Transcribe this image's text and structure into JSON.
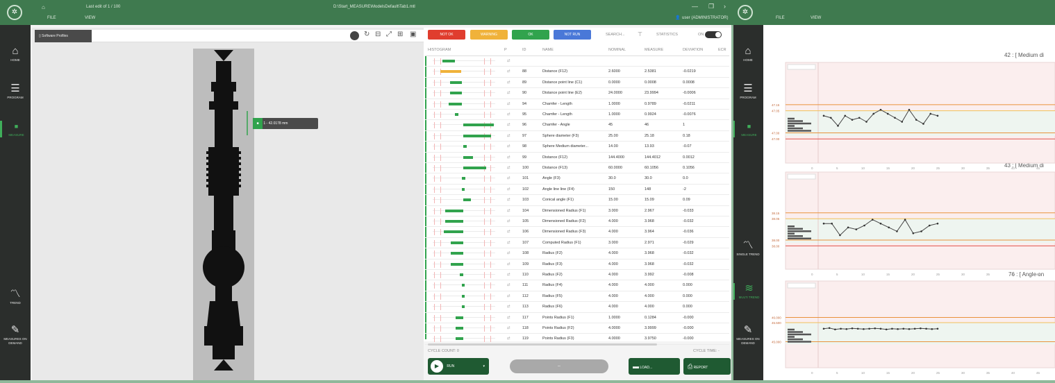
{
  "left_window": {
    "title_bar": {
      "file_label": "FILE",
      "view_label": "VIEW",
      "recent_label": "Last edit of 1 / 100",
      "title": "D:\\Start_MEASURE\\ModelsDefault\\Tab1.mtl",
      "user": "user (ADMINISTRATOR)"
    },
    "sidebar": {
      "items": [
        {
          "label": "HOME",
          "icon": "home-icon"
        },
        {
          "label": "PROGRAM",
          "icon": "list-icon"
        },
        {
          "label": "MEASURE",
          "icon": "measure-icon"
        },
        {
          "label": "TREND",
          "icon": "trend-icon"
        },
        {
          "label": "MEASURES ON DEMAND",
          "icon": "wand-icon"
        }
      ]
    },
    "viewer": {
      "tab_label": "Software Profiles",
      "measure_tag": "1 - 42.0178 mm"
    },
    "table": {
      "buttons": {
        "not_ok": "NOT OK",
        "warning": "WARNING",
        "ok": "OK",
        "not_run": "NOT RUN"
      },
      "toolbar": {
        "search": "SEARCH...",
        "statistics": "STATISTICS",
        "on": "ON"
      },
      "headers": {
        "histogram": "HISTOGRAM",
        "p": "P",
        "id": "ID",
        "name": "NAME",
        "nominal": "NOMINAL",
        "measure": "MEASURE",
        "deviation": "DEVIATION",
        "extra": "ECR"
      },
      "rows": [
        {
          "id": "",
          "name": "",
          "nominal": "",
          "measure": "",
          "deviation": ""
        },
        {
          "id": "88",
          "name": "Distance (F12)",
          "nominal": "2.6000",
          "measure": "2.5381",
          "deviation": "-0.0219"
        },
        {
          "id": "89",
          "name": "Distance point line (C1)",
          "nominal": "0.0000",
          "measure": "0.0008",
          "deviation": "0.0008"
        },
        {
          "id": "90",
          "name": "Distance point line (E2)",
          "nominal": "24.0000",
          "measure": "23.9994",
          "deviation": "-0.0006"
        },
        {
          "id": "94",
          "name": "Chamfer - Length",
          "nominal": "1.0000",
          "measure": "0.9789",
          "deviation": "-0.0211"
        },
        {
          "id": "95",
          "name": "Chamfer - Length",
          "nominal": "1.0000",
          "measure": "0.9924",
          "deviation": "-0.0076"
        },
        {
          "id": "96",
          "name": "Chamfer - Angle",
          "nominal": "45",
          "measure": "46",
          "deviation": "1"
        },
        {
          "id": "97",
          "name": "Sphere diameter (F3)",
          "nominal": "25.00",
          "measure": "25.18",
          "deviation": "0.18"
        },
        {
          "id": "98",
          "name": "Sphere Medium diameter...",
          "nominal": "14.00",
          "measure": "13.93",
          "deviation": "-0.07"
        },
        {
          "id": "99",
          "name": "Distance (F12)",
          "nominal": "144.4000",
          "measure": "144.4012",
          "deviation": "0.0012"
        },
        {
          "id": "100",
          "name": "Distance (F13)",
          "nominal": "60.0000",
          "measure": "60.1056",
          "deviation": "0.1056"
        },
        {
          "id": "101",
          "name": "Angle (F3)",
          "nominal": "30.0",
          "measure": "30.0",
          "deviation": "0.0"
        },
        {
          "id": "102",
          "name": "Angle line line (F4)",
          "nominal": "150",
          "measure": "148",
          "deviation": "-2"
        },
        {
          "id": "103",
          "name": "Conical angle (F1)",
          "nominal": "15.00",
          "measure": "15.09",
          "deviation": "0.09"
        },
        {
          "id": "104",
          "name": "Dimensioned Radius (F1)",
          "nominal": "3.000",
          "measure": "2.967",
          "deviation": "-0.033"
        },
        {
          "id": "105",
          "name": "Dimensioned Radius (F2)",
          "nominal": "4.000",
          "measure": "3.968",
          "deviation": "-0.032"
        },
        {
          "id": "106",
          "name": "Dimensioned Radius (F3)",
          "nominal": "4.000",
          "measure": "3.964",
          "deviation": "-0.036"
        },
        {
          "id": "107",
          "name": "Computed Radius (F1)",
          "nominal": "3.000",
          "measure": "2.971",
          "deviation": "-0.029"
        },
        {
          "id": "108",
          "name": "Radius (F2)",
          "nominal": "4.000",
          "measure": "3.968",
          "deviation": "-0.032"
        },
        {
          "id": "109",
          "name": "Radius (F3)",
          "nominal": "4.000",
          "measure": "3.968",
          "deviation": "-0.032"
        },
        {
          "id": "110",
          "name": "Radius (F2)",
          "nominal": "4.000",
          "measure": "3.992",
          "deviation": "-0.008"
        },
        {
          "id": "111",
          "name": "Radius (F4)",
          "nominal": "4.000",
          "measure": "4.000",
          "deviation": "0.000"
        },
        {
          "id": "112",
          "name": "Radius (F5)",
          "nominal": "4.000",
          "measure": "4.000",
          "deviation": "0.000"
        },
        {
          "id": "113",
          "name": "Radius (F6)",
          "nominal": "4.000",
          "measure": "4.000",
          "deviation": "0.000"
        },
        {
          "id": "117",
          "name": "Points Radius (F1)",
          "nominal": "1.0000",
          "measure": "0.1284",
          "deviation": "-0.000"
        },
        {
          "id": "118",
          "name": "Points Radius (F2)",
          "nominal": "4.0000",
          "measure": "3.9999",
          "deviation": "-0.000"
        },
        {
          "id": "119",
          "name": "Points Radius (F3)",
          "nominal": "4.0000",
          "measure": "3.9750",
          "deviation": "-0.000"
        }
      ],
      "histogram_fills": [
        {
          "start": 0.16,
          "width": 0.2,
          "color": "#31a34d"
        },
        {
          "start": 0.12,
          "width": 0.35,
          "color": "#f0b23a"
        },
        {
          "start": 0.28,
          "width": 0.2,
          "color": "#31a34d"
        },
        {
          "start": 0.28,
          "width": 0.2,
          "color": "#31a34d"
        },
        {
          "start": 0.26,
          "width": 0.22,
          "color": "#31a34d"
        },
        {
          "start": 0.36,
          "width": 0.06,
          "color": "#31a34d"
        },
        {
          "start": 0.5,
          "width": 0.5,
          "color": "#31a34d"
        },
        {
          "start": 0.5,
          "width": 0.45,
          "color": "#31a34d"
        },
        {
          "start": 0.5,
          "width": 0.06,
          "color": "#31a34d"
        },
        {
          "start": 0.5,
          "width": 0.16,
          "color": "#31a34d"
        },
        {
          "start": 0.5,
          "width": 0.38,
          "color": "#31a34d"
        },
        {
          "start": 0.48,
          "width": 0.05,
          "color": "#31a34d"
        },
        {
          "start": 0.48,
          "width": 0.04,
          "color": "#31a34d"
        },
        {
          "start": 0.5,
          "width": 0.12,
          "color": "#31a34d"
        },
        {
          "start": 0.2,
          "width": 0.3,
          "color": "#31a34d"
        },
        {
          "start": 0.2,
          "width": 0.3,
          "color": "#31a34d"
        },
        {
          "start": 0.18,
          "width": 0.32,
          "color": "#31a34d"
        },
        {
          "start": 0.3,
          "width": 0.2,
          "color": "#31a34d"
        },
        {
          "start": 0.3,
          "width": 0.2,
          "color": "#31a34d"
        },
        {
          "start": 0.3,
          "width": 0.2,
          "color": "#31a34d"
        },
        {
          "start": 0.44,
          "width": 0.06,
          "color": "#31a34d"
        },
        {
          "start": 0.48,
          "width": 0.04,
          "color": "#31a34d"
        },
        {
          "start": 0.48,
          "width": 0.04,
          "color": "#31a34d"
        },
        {
          "start": 0.48,
          "width": 0.04,
          "color": "#31a34d"
        },
        {
          "start": 0.38,
          "width": 0.12,
          "color": "#31a34d"
        },
        {
          "start": 0.38,
          "width": 0.12,
          "color": "#31a34d"
        },
        {
          "start": 0.38,
          "width": 0.12,
          "color": "#31a34d"
        }
      ],
      "footer": {
        "cycle_count": "CYCLE COUNT: 0",
        "cycle_time": "CYCLE TIME: -"
      }
    },
    "bottom_bar": {
      "run": "RUN",
      "center": "–",
      "load": "LOAD...",
      "report": "REPORT"
    }
  },
  "right_window": {
    "title_bar": {
      "file_label": "FILE",
      "view_label": "VIEW"
    },
    "sidebar": {
      "items": [
        {
          "label": "HOME",
          "icon": "home-icon"
        },
        {
          "label": "PROGRAM",
          "icon": "list-icon"
        },
        {
          "label": "MEASURE",
          "icon": "measure-icon"
        },
        {
          "label": "SINGLE TREND",
          "icon": "trend-icon"
        },
        {
          "label": "MULTI TREND",
          "icon": "multi-trend-icon"
        },
        {
          "label": "MEASURES ON DEMAND",
          "icon": "wand-icon"
        }
      ]
    },
    "charts": [
      {
        "title": "42 : [ Medium di",
        "limits": [
          "47.15",
          "47.05",
          "47.00",
          "47.00"
        ],
        "chart_data": {
          "type": "line",
          "x_tick_labels": [
            "0",
            "5",
            "10",
            "15",
            "20",
            "25",
            "30",
            "35",
            "40",
            "45"
          ],
          "values": [
            0.55,
            0.5,
            0.3,
            0.55,
            0.45,
            0.5,
            0.4,
            0.6,
            0.7,
            0.6,
            0.5,
            0.4,
            0.7,
            0.45,
            0.35,
            0.6,
            0.55
          ]
        }
      },
      {
        "title": "43 : [ Medium di",
        "limits": [
          "38.15",
          "38.05",
          "38.00",
          "38.00"
        ],
        "chart_data": {
          "type": "line",
          "x_tick_labels": [
            "0",
            "5",
            "10",
            "15",
            "20",
            "25",
            "30",
            "35",
            "40",
            "45"
          ],
          "values": [
            0.55,
            0.55,
            0.25,
            0.45,
            0.4,
            0.5,
            0.65,
            0.55,
            0.45,
            0.35,
            0.65,
            0.3,
            0.35,
            0.5,
            0.55
          ]
        }
      },
      {
        "title": "76 : [ Angle on",
        "limits": [
          "46.000",
          "45.500",
          "45.000"
        ],
        "chart_data": {
          "type": "line",
          "x_tick_labels": [
            "0",
            "5",
            "10",
            "15",
            "20",
            "25",
            "30",
            "35",
            "40",
            "45"
          ],
          "values": [
            0.5,
            0.52,
            0.48,
            0.5,
            0.49,
            0.51,
            0.5,
            0.49,
            0.5,
            0.51,
            0.5,
            0.48,
            0.5,
            0.49,
            0.5,
            0.49,
            0.5,
            0.51,
            0.5,
            0.49,
            0.5
          ]
        }
      }
    ]
  },
  "colors": {
    "brand_green": "#3f7a4f",
    "ok": "#31a34d",
    "warning": "#f0b23a",
    "not_ok": "#e03d2e",
    "not_run": "#4a78d8"
  }
}
